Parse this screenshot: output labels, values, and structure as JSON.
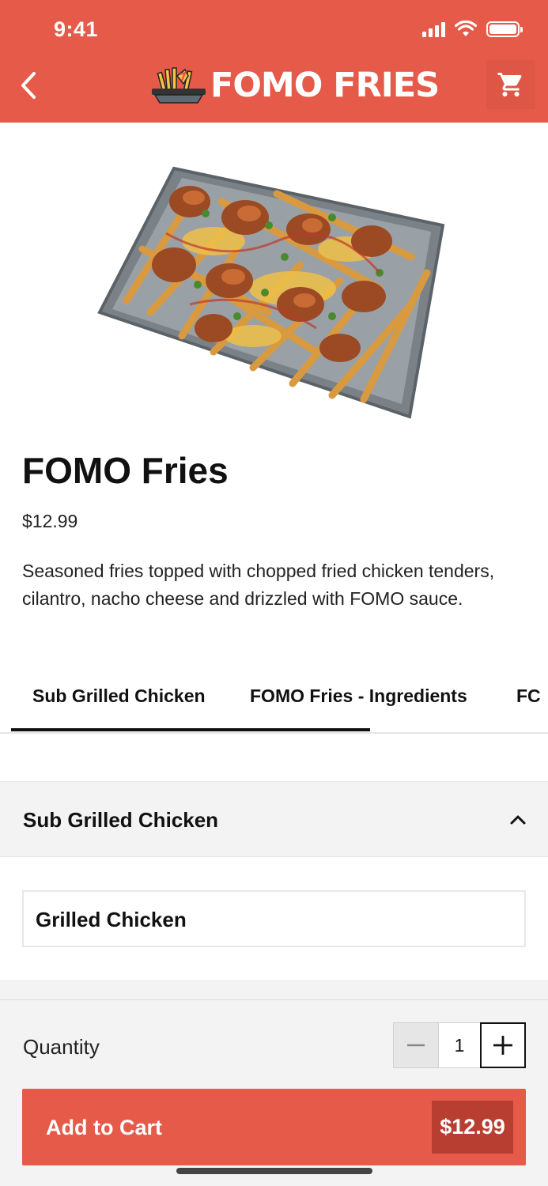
{
  "colors": {
    "brand": "#e65a49",
    "brand_dark": "#b83e31",
    "section_bg": "#f3f3f3"
  },
  "status_bar": {
    "time": "9:41",
    "icons": [
      "signal-icon",
      "wifi-icon",
      "battery-icon"
    ]
  },
  "header": {
    "back_icon": "chevron-left-icon",
    "logo_text": "FOMO FRIES",
    "cart_icon": "cart-icon"
  },
  "product": {
    "image": "fries-tray-image",
    "name": "FOMO Fries",
    "price": "$12.99",
    "description": "Seasoned fries topped with chopped fried chicken tenders, cilantro, nacho cheese and drizzled with FOMO sauce."
  },
  "tabs": [
    {
      "label": "Sub Grilled Chicken",
      "active": true
    },
    {
      "label": "FOMO Fries - Ingredients",
      "active": false
    },
    {
      "label": "FC",
      "active": false
    }
  ],
  "section": {
    "title": "Sub Grilled Chicken",
    "expanded": true,
    "options": [
      "Grilled Chicken"
    ]
  },
  "footer": {
    "quantity_label": "Quantity",
    "quantity": "1",
    "add_to_cart_label": "Add to Cart",
    "total": "$12.99"
  }
}
